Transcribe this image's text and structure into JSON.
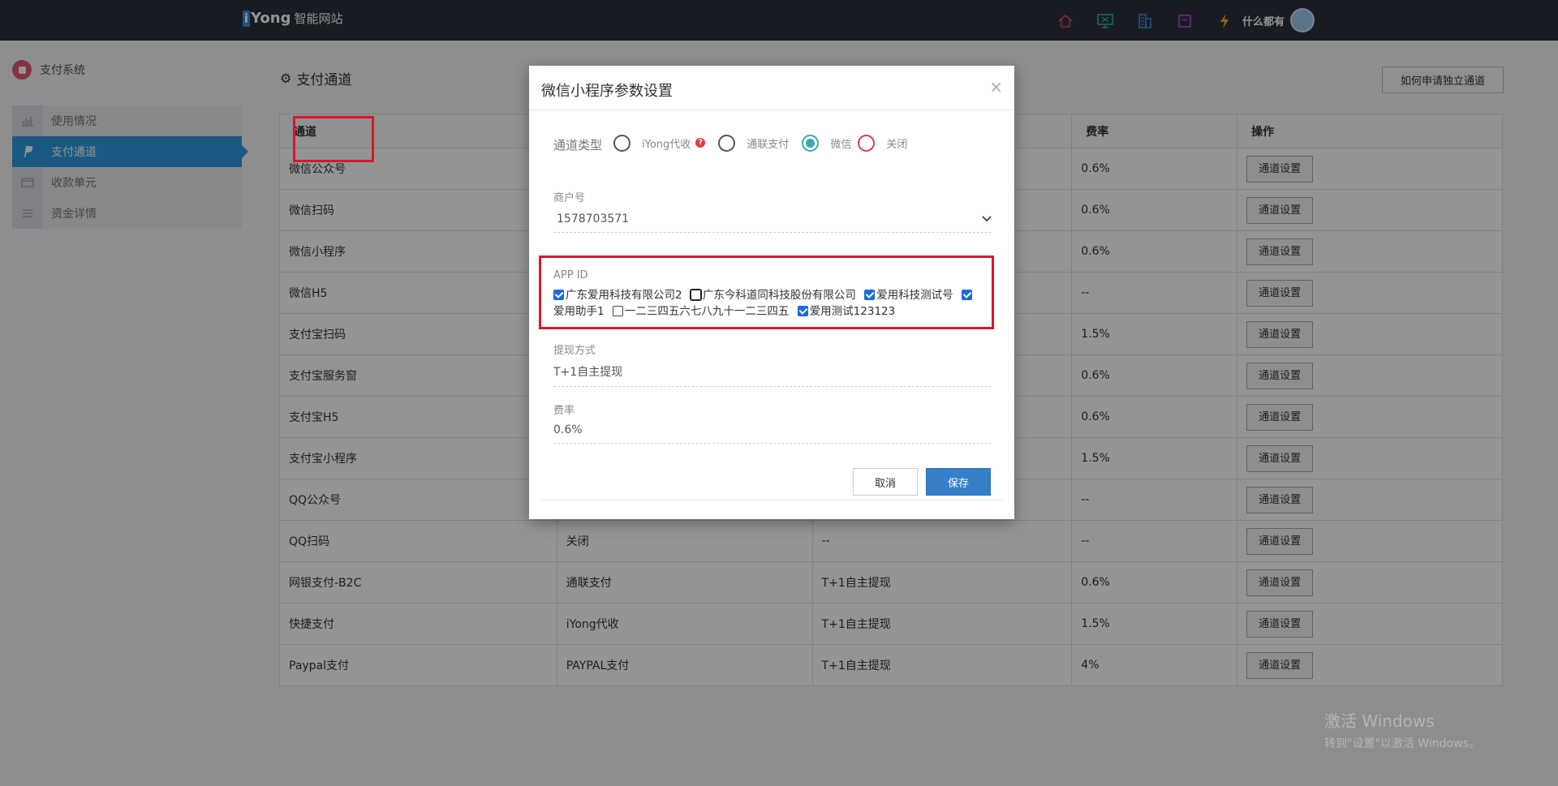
{
  "topbar": {
    "brand_i": "i",
    "brand_name": "Yong",
    "brand_suffix": "智能网站",
    "user_name": "什么都有",
    "icons": [
      "home-icon",
      "monitor-icon",
      "building-icon",
      "bag-icon",
      "lightning-icon"
    ],
    "colors": {
      "home": "#e0445a",
      "monitor": "#2bb0a6",
      "building": "#3b8ee0",
      "bag": "#b04fd3",
      "lightning": "#f2b81c"
    }
  },
  "sidebar": {
    "system_title": "支付系统",
    "items": [
      {
        "label": "使用情况",
        "icon": "chart-icon",
        "active": false
      },
      {
        "label": "支付通道",
        "icon": "paypal-icon",
        "active": true
      },
      {
        "label": "收款单元",
        "icon": "card-icon",
        "active": false
      },
      {
        "label": "资金详情",
        "icon": "list-icon",
        "active": false
      }
    ]
  },
  "page": {
    "title": "支付通道",
    "apply_button": "如何申请独立通道"
  },
  "table": {
    "headers": [
      "通道",
      "",
      "",
      "费率",
      "操作"
    ],
    "action_label": "通道设置",
    "rows": [
      {
        "channel": "微信公众号",
        "type": "",
        "withdraw": "",
        "rate": "0.6%"
      },
      {
        "channel": "微信扫码",
        "type": "",
        "withdraw": "",
        "rate": "0.6%"
      },
      {
        "channel": "微信小程序",
        "type": "",
        "withdraw": "",
        "rate": "0.6%"
      },
      {
        "channel": "微信H5",
        "type": "",
        "withdraw": "",
        "rate": "--"
      },
      {
        "channel": "支付宝扫码",
        "type": "",
        "withdraw": "",
        "rate": "1.5%"
      },
      {
        "channel": "支付宝服务窗",
        "type": "",
        "withdraw": "",
        "rate": "0.6%"
      },
      {
        "channel": "支付宝H5",
        "type": "",
        "withdraw": "",
        "rate": "0.6%"
      },
      {
        "channel": "支付宝小程序",
        "type": "",
        "withdraw": "",
        "rate": "1.5%"
      },
      {
        "channel": "QQ公众号",
        "type": "",
        "withdraw": "",
        "rate": "--"
      },
      {
        "channel": "QQ扫码",
        "type": "关闭",
        "withdraw": "--",
        "rate": "--"
      },
      {
        "channel": "网银支付-B2C",
        "type": "通联支付",
        "withdraw": "T+1自主提现",
        "rate": "0.6%"
      },
      {
        "channel": "快捷支付",
        "type": "iYong代收",
        "withdraw": "T+1自主提现",
        "rate": "1.5%"
      },
      {
        "channel": "Paypal支付",
        "type": "PAYPAL支付",
        "withdraw": "T+1自主提现",
        "rate": "4%"
      }
    ]
  },
  "modal": {
    "title": "微信小程序参数设置",
    "close": "×",
    "channel_type_label": "通道类型",
    "channel_types": [
      {
        "label": "iYong代收",
        "checked": false,
        "help": "?"
      },
      {
        "label": "通联支付",
        "checked": false
      },
      {
        "label": "微信",
        "checked": true
      },
      {
        "label": "关闭",
        "checked": false
      }
    ],
    "merchant_label": "商户号",
    "merchant_value": "1578703571",
    "appid_label": "APP ID",
    "appids": [
      {
        "label": "广东爱用科技有限公司2",
        "checked": true
      },
      {
        "label": "广东今科道同科技股份有限公司",
        "checked": false,
        "focused": true
      },
      {
        "label": "爱用科技测试号",
        "checked": true
      },
      {
        "label": "爱用助手1",
        "checked": true
      },
      {
        "label": "一二三四五六七八九十一二三四五",
        "checked": false
      },
      {
        "label": "爱用测试123123",
        "checked": true
      }
    ],
    "withdraw_label": "提现方式",
    "withdraw_value": "T+1自主提现",
    "rate_label": "费率",
    "rate_value": "0.6%",
    "cancel_label": "取消",
    "save_label": "保存"
  },
  "watermark": {
    "line1": "激活 Windows",
    "line2": "转到\"设置\"以激活 Windows。"
  }
}
